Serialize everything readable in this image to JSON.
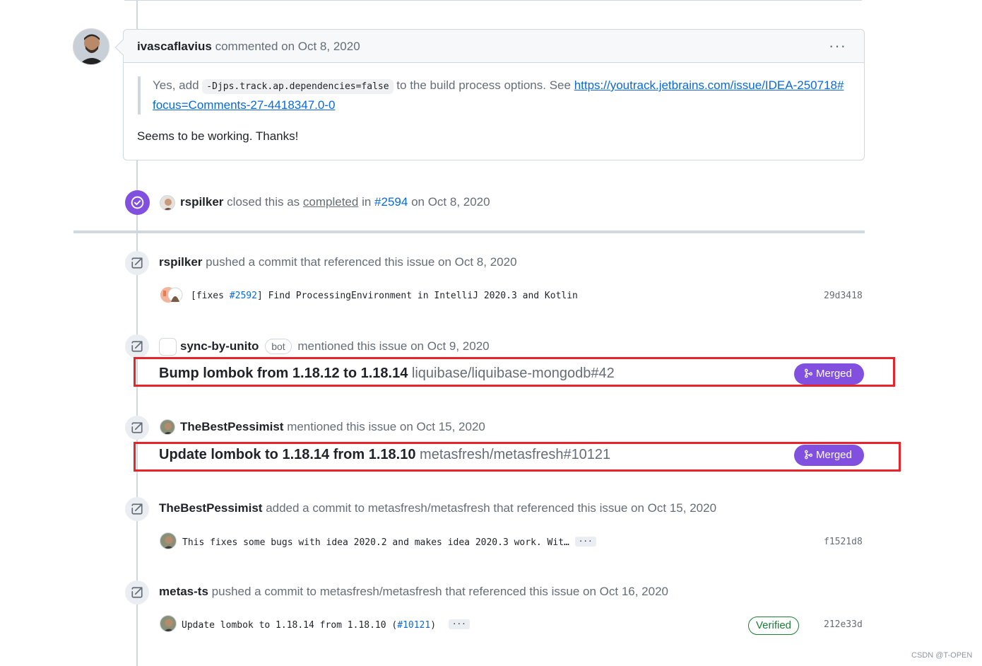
{
  "comment": {
    "author": "ivascaflavius",
    "action": "commented on Oct 8, 2020",
    "quote_prefix": "Yes, add",
    "quote_code": "-Djps.track.ap.dependencies=false",
    "quote_mid": "to the build process options. See",
    "quote_link": "https://youtrack.jetbrains.com/issue/IDEA-250718#focus=Comments-27-4418347.0-0",
    "reply": "Seems to be working. Thanks!",
    "menu": "···"
  },
  "closed_event": {
    "user": "rspilker",
    "text1": "closed this as",
    "state": "completed",
    "text2": "in",
    "ref": "#2594",
    "text3": "on Oct 8, 2020"
  },
  "events": [
    {
      "user": "rspilker",
      "text": "pushed a commit that referenced this issue on Oct 8, 2020",
      "commit_prefix": "[fixes ",
      "commit_ref": "#2592",
      "commit_suffix": "] Find ProcessingEnvironment in IntelliJ 2020.3 and Kotlin",
      "sha": "29d3418"
    },
    {
      "user": "sync-by-unito",
      "badge": "bot",
      "text": "mentioned this issue on Oct 9, 2020",
      "ref_title": "Bump lombok from 1.18.12 to 1.18.14",
      "ref_repo": "liquibase/liquibase-mongodb#42",
      "state": "Merged"
    },
    {
      "user": "TheBestPessimist",
      "text": "mentioned this issue on Oct 15, 2020",
      "ref_title": "Update lombok to 1.18.14 from 1.18.10",
      "ref_repo": "metasfresh/metasfresh#10121",
      "state": "Merged"
    },
    {
      "user": "TheBestPessimist",
      "text": "added a commit to metasfresh/metasfresh that referenced this issue on Oct 15, 2020",
      "commit_msg": "This fixes some bugs with idea 2020.2 and makes idea 2020.3 work. Wit…",
      "ellipsis": "···",
      "sha": "f1521d8"
    },
    {
      "user": "metas-ts",
      "text": "pushed a commit to metasfresh/metasfresh that referenced this issue on Oct 16, 2020",
      "commit_prefix": "Update lombok to 1.18.14 from 1.18.10 (",
      "commit_ref": "#10121",
      "commit_suffix": ")",
      "ellipsis": "···",
      "verified": "Verified",
      "sha": "212e33d"
    }
  ],
  "watermark": "CSDN @T-OPEN",
  "colors": {
    "purple": "#8250df",
    "link": "#0969da",
    "border": "#d0d7de",
    "highlight": "#e8232a",
    "verified": "#1a7f37"
  }
}
